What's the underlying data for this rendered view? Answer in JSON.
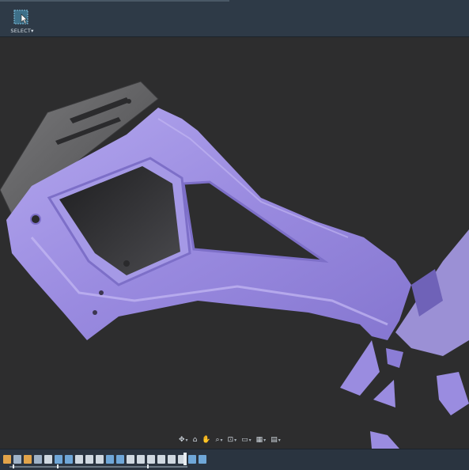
{
  "toolbar": {
    "select_label": "SELECT",
    "select_dropdown_glyph": "▾"
  },
  "navigation_bar": {
    "items": [
      {
        "name": "orbit",
        "glyph": "✥",
        "has_dropdown": true
      },
      {
        "name": "look-at",
        "glyph": "⌂",
        "has_dropdown": false
      },
      {
        "name": "pan",
        "glyph": "✋",
        "has_dropdown": false
      },
      {
        "name": "zoom",
        "glyph": "⌕",
        "has_dropdown": true
      },
      {
        "name": "fit",
        "glyph": "⊡",
        "has_dropdown": true
      },
      {
        "name": "display-settings",
        "glyph": "▭",
        "has_dropdown": true
      },
      {
        "name": "grid-and-snaps",
        "glyph": "▦",
        "has_dropdown": true
      },
      {
        "name": "viewports",
        "glyph": "▤",
        "has_dropdown": true
      }
    ],
    "caret_glyph": "▾"
  },
  "timeline": {
    "item_colors": [
      "#e0a34a",
      "#9fb3c8",
      "#e0a34a",
      "#9fb3c8",
      "#cfd8e0",
      "#6fa7d8",
      "#6fa7d8",
      "#cfd8e0",
      "#cfd8e0",
      "#cfd8e0",
      "#6fa7d8",
      "#6fa7d8",
      "#cfd8e0",
      "#cfd8e0",
      "#cfd8e0",
      "#cfd8e0",
      "#cfd8e0",
      "#cfd8e0",
      "#6fa7d8",
      "#6fa7d8"
    ]
  },
  "colors": {
    "toolbar_bg": "#2e3a47",
    "viewport_bg": "#2d2d2e",
    "mesh_purple": "#9b8ce0",
    "plate_gray": "#5c5c5e"
  }
}
